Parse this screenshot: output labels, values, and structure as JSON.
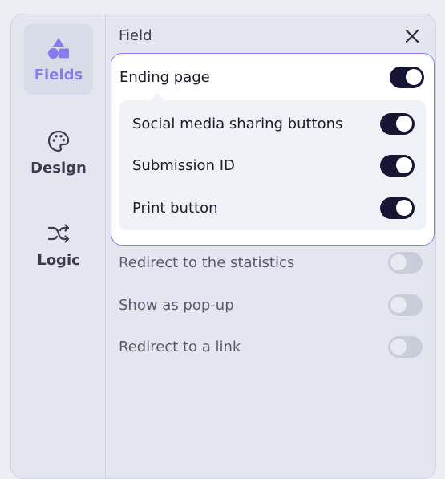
{
  "rail": {
    "items": [
      {
        "label": "Fields",
        "icon": "shapes-icon",
        "active": true
      },
      {
        "label": "Design",
        "icon": "palette-icon",
        "active": false
      },
      {
        "label": "Logic",
        "icon": "shuffle-icon",
        "active": false
      }
    ]
  },
  "header": {
    "title": "Field",
    "close_icon": "close-icon"
  },
  "ending_page": {
    "label": "Ending page",
    "enabled": true,
    "options": [
      {
        "label": "Social media sharing buttons",
        "enabled": true
      },
      {
        "label": "Submission ID",
        "enabled": true
      },
      {
        "label": "Print button",
        "enabled": true
      }
    ]
  },
  "settings": [
    {
      "label": "Redirect to the statistics",
      "enabled": false
    },
    {
      "label": "Show as pop-up",
      "enabled": false
    },
    {
      "label": "Redirect to a link",
      "enabled": false
    }
  ],
  "colors": {
    "accent": "#8a7af0",
    "toggle_on": "#161533",
    "toggle_off": "#c9cdd8"
  }
}
